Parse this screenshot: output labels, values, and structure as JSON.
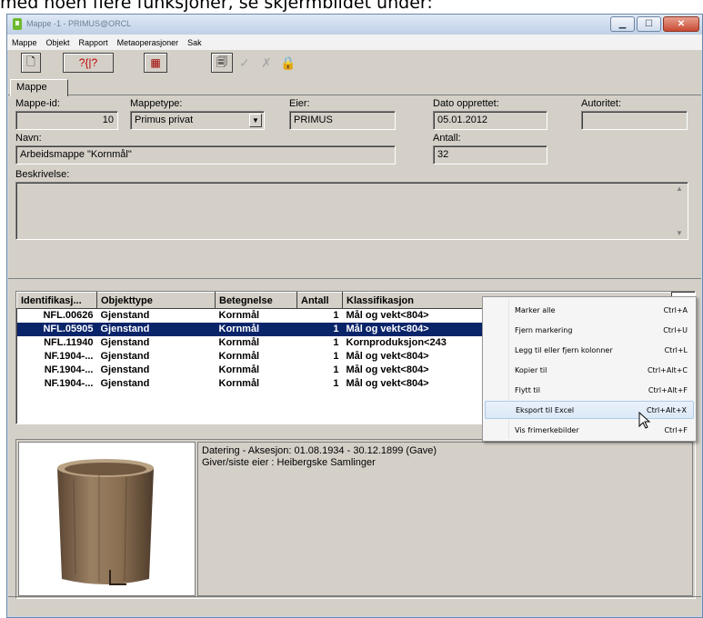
{
  "caption_text": "med noen flere funksjoner, se skjermbildet under:",
  "window": {
    "title": "Mappe -1 - PRIMUS@ORCL",
    "min_icon": "minimize-icon",
    "max_icon": "maximize-icon",
    "close_icon": "close-icon"
  },
  "menubar": [
    "Mappe",
    "Objekt",
    "Rapport",
    "Metaoperasjoner",
    "Sak"
  ],
  "toolbar": {
    "new_glyph": "🗋",
    "search_glyph": "?{|?",
    "calc_glyph": "▦",
    "copy_glyph": "🗐",
    "ok_glyph": "✓",
    "cancel_glyph": "✗",
    "lock_glyph": "🔒"
  },
  "tab": {
    "label": "Mappe"
  },
  "form": {
    "mappe_id_label": "Mappe-id:",
    "mappe_id_value": "10",
    "mappetype_label": "Mappetype:",
    "mappetype_value": "Primus privat",
    "eier_label": "Eier:",
    "eier_value": "PRIMUS",
    "dato_label": "Dato opprettet:",
    "dato_value": "05.01.2012",
    "autoritet_label": "Autoritet:",
    "autoritet_value": "",
    "navn_label": "Navn:",
    "navn_value": "Arbeidsmappe \"Kornmål\"",
    "antall_label": "Antall:",
    "antall_value": "32",
    "beskrivelse_label": "Beskrivelse:",
    "beskrivelse_value": ""
  },
  "grid": {
    "columns": [
      "Identifikasj...",
      "Objekttype",
      "Betegnelse",
      "Antall",
      "Klassifikasjon"
    ],
    "rows": [
      [
        "NFL.00626",
        "Gjenstand",
        "Kornmål",
        "1",
        "Mål og vekt<804>"
      ],
      [
        "NFL.05905",
        "Gjenstand",
        "Kornmål",
        "1",
        "Mål og vekt<804>"
      ],
      [
        "NFL.11940",
        "Gjenstand",
        "Kornmål",
        "1",
        "Kornproduksjon<243"
      ],
      [
        "NF.1904-...",
        "Gjenstand",
        "Kornmål",
        "1",
        "Mål og vekt<804>"
      ],
      [
        "NF.1904-...",
        "Gjenstand",
        "Kornmål",
        "1",
        "Mål og vekt<804>"
      ],
      [
        "NF.1904-...",
        "Gjenstand",
        "Kornmål",
        "1",
        "Mål og vekt<804>"
      ]
    ],
    "selected_row": 1
  },
  "detail": {
    "line1": "Datering - Aksesjon: 01.08.1934 - 30.12.1899 (Gave)",
    "line2": "Giver/siste eier : Heibergske Samlinger"
  },
  "context_menu": [
    {
      "label": "Marker alle",
      "shortcut": "Ctrl+A"
    },
    {
      "label": "Fjern markering",
      "shortcut": "Ctrl+U"
    },
    {
      "label": "Legg til eller fjern kolonner",
      "shortcut": "Ctrl+L"
    },
    {
      "label": "Kopier til",
      "shortcut": "Ctrl+Alt+C"
    },
    {
      "label": "Flytt til",
      "shortcut": "Ctrl+Alt+F"
    },
    {
      "label": "Eksport til Excel",
      "shortcut": "Ctrl+Alt+X"
    },
    {
      "label": "Vis frimerkebilder",
      "shortcut": "Ctrl+F"
    }
  ],
  "colors": {
    "selection": "#0a246a",
    "face": "#d4d0c8",
    "frame": "#c8d7ea",
    "menu_highlight": "#dbe8f6"
  }
}
